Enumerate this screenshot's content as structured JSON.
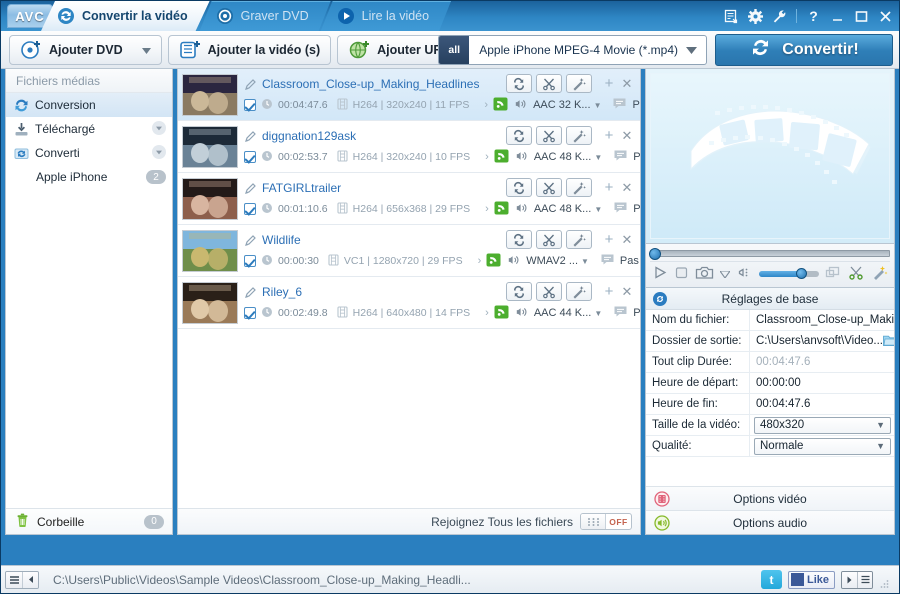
{
  "app": {
    "logo": "AVC"
  },
  "tabs": [
    {
      "label": "Convertir la vidéo",
      "icon": "convert-icon",
      "active": true
    },
    {
      "label": "Graver DVD",
      "icon": "disc-icon",
      "active": false
    },
    {
      "label": "Lire la vidéo",
      "icon": "play-icon",
      "active": false
    }
  ],
  "window_controls": [
    {
      "name": "list-icon",
      "glyph": "▤"
    },
    {
      "name": "gear-icon",
      "glyph": "✿"
    },
    {
      "name": "wrench-icon",
      "glyph": "✎"
    },
    {
      "name": "help-icon",
      "glyph": "?"
    },
    {
      "name": "minimize-icon",
      "glyph": "—"
    },
    {
      "name": "maximize-icon",
      "glyph": "❐"
    },
    {
      "name": "close-icon",
      "glyph": "✕"
    }
  ],
  "toolbar": {
    "add_dvd": "Ajouter DVD",
    "add_video": "Ajouter la vidéo (s)",
    "add_url": "Ajouter URL (s)",
    "profile_badge": "all",
    "profile": "Apple iPhone MPEG-4 Movie (*.mp4)",
    "convert": "Convertir!"
  },
  "sidebar": {
    "header": "Fichiers médias",
    "items": [
      {
        "label": "Conversion",
        "icon": "convert-icon",
        "selected": true,
        "badge": "",
        "chevron": false,
        "child": false
      },
      {
        "label": "Téléchargé",
        "icon": "download-icon",
        "selected": false,
        "badge": "",
        "chevron": true,
        "child": false
      },
      {
        "label": "Converti",
        "icon": "converted-icon",
        "selected": false,
        "badge": "",
        "chevron": true,
        "child": false
      },
      {
        "label": "Apple iPhone",
        "icon": "",
        "selected": false,
        "badge": "2",
        "chevron": false,
        "child": true
      }
    ],
    "trash": {
      "label": "Corbeille",
      "count": "0",
      "icon": "trash-icon"
    }
  },
  "filelist": {
    "rows": [
      {
        "name": "Classroom_Close-up_Making_Headlines",
        "duration": "00:04:47.6",
        "meta": "H264 | 320x240 | 11 FPS",
        "audio": "AAC 32 K...",
        "subtitle": "Pas de s...",
        "checked": true,
        "selected": true,
        "thumb_colors": [
          "#2b2640",
          "#8a7a62",
          "#cbb898"
        ]
      },
      {
        "name": "diggnation129ask",
        "duration": "00:02:53.7",
        "meta": "H264 | 320x240 | 10 FPS",
        "audio": "AAC 48 K...",
        "subtitle": "Pas de s...",
        "checked": true,
        "selected": false,
        "thumb_colors": [
          "#1d2a38",
          "#6a8296",
          "#c2cfd8"
        ]
      },
      {
        "name": "FATGIRLtrailer",
        "duration": "00:01:10.6",
        "meta": "H264 | 656x368 | 29 FPS",
        "audio": "AAC 48 K...",
        "subtitle": "Pas de s...",
        "checked": true,
        "selected": false,
        "thumb_colors": [
          "#231a18",
          "#8d5f4c",
          "#d8b5a0"
        ]
      },
      {
        "name": "Wildlife",
        "duration": "00:00:30",
        "meta": "VC1 | 1280x720 | 29 FPS",
        "audio": "WMAV2 ...",
        "subtitle": "Pas de s...",
        "checked": true,
        "selected": false,
        "thumb_colors": [
          "#7fb6dd",
          "#6f8e4a",
          "#c9b86f"
        ]
      },
      {
        "name": "Riley_6",
        "duration": "00:02:49.8",
        "meta": "H264 | 640x480 | 14 FPS",
        "audio": "AAC 44 K...",
        "subtitle": "Pas de s...",
        "checked": true,
        "selected": false,
        "thumb_colors": [
          "#2a2018",
          "#9a7a58",
          "#e0c9a8"
        ]
      }
    ],
    "row_actions": [
      {
        "name": "convert-row-icon"
      },
      {
        "name": "scissors-icon"
      },
      {
        "name": "magic-wand-icon"
      }
    ],
    "footer": {
      "join_label": "Rejoignez Tous les fichiers",
      "toggle_state": "OFF"
    }
  },
  "settings": {
    "title": "Réglages de base",
    "rows": [
      {
        "label": "Nom du fichier:",
        "value": "Classroom_Close-up_Maki...",
        "type": "text",
        "dim": false
      },
      {
        "label": "Dossier de sortie:",
        "value": "C:\\Users\\anvsoft\\Video...",
        "type": "folder",
        "dim": false
      },
      {
        "label": "Tout clip Durée:",
        "value": "00:04:47.6",
        "type": "text",
        "dim": true
      },
      {
        "label": "Heure de départ:",
        "value": "00:00:00",
        "type": "text",
        "dim": false
      },
      {
        "label": "Heure de fin:",
        "value": "00:04:47.6",
        "type": "text",
        "dim": false
      },
      {
        "label": "Taille de la vidéo:",
        "value": "480x320",
        "type": "select",
        "dim": false
      },
      {
        "label": "Qualité:",
        "value": "Normale",
        "type": "select",
        "dim": false
      }
    ],
    "video_options": "Options vidéo",
    "audio_options": "Options audio"
  },
  "statusbar": {
    "path": "C:\\Users\\Public\\Videos\\Sample Videos\\Classroom_Close-up_Making_Headli...",
    "facebook_like": "Like",
    "facebook_f": "f",
    "twitter": "t"
  },
  "colors": {
    "accent": "#2f7fb8",
    "title_bar": "#2e86c4",
    "link": "#2c6fb5",
    "selected_row": "#d2e7f8",
    "off_text": "#c4634e"
  }
}
